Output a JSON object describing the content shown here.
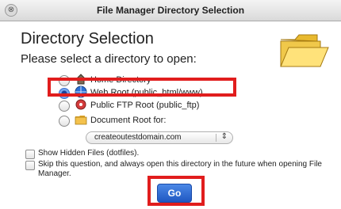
{
  "window": {
    "title": "File Manager Directory Selection",
    "close_glyph": "⊗"
  },
  "main": {
    "heading": "Directory Selection",
    "prompt": "Please select a directory to open:",
    "folder_icon": "folder-icon"
  },
  "options": [
    {
      "label": "Home Directory",
      "icon": "home-icon",
      "checked": false
    },
    {
      "label": "Web Root (public_html/www)",
      "icon": "globe-icon",
      "checked": true
    },
    {
      "label": "Public FTP Root (public_ftp)",
      "icon": "ftp-icon",
      "checked": false
    },
    {
      "label": "Document Root for:",
      "icon": "folder-icon",
      "checked": false
    }
  ],
  "domain_select": {
    "value": "createoutestdomain.com",
    "arrows": "⇕"
  },
  "checkboxes": {
    "hidden_files": "Show Hidden Files (dotfiles).",
    "skip_question": "Skip this question, and always open this directory in the future when opening File Manager."
  },
  "actions": {
    "go_label": "Go"
  },
  "colors": {
    "highlight": "#e11d1d",
    "button": "#1f57c2"
  }
}
